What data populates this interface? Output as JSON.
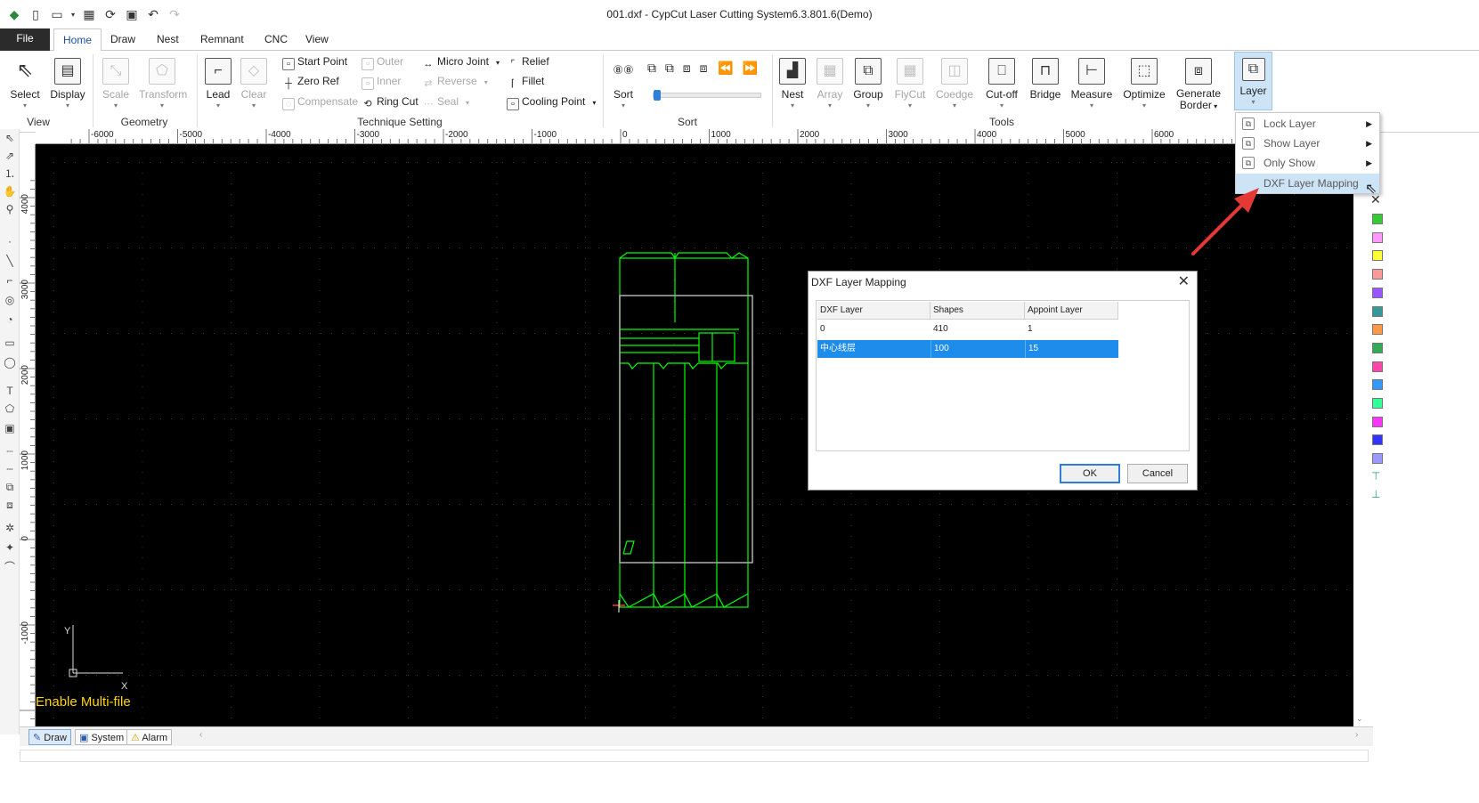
{
  "window": {
    "title": "001.dxf - CypCut Laser Cutting System6.3.801.6(Demo)"
  },
  "tabs": {
    "file": "File",
    "home": "Home",
    "draw": "Draw",
    "nest": "Nest",
    "remnant": "Remnant",
    "cnc": "CNC",
    "view": "View"
  },
  "ribbon": {
    "select": "Select",
    "display": "Display",
    "scale": "Scale",
    "transform": "Transform",
    "lead": "Lead",
    "clear": "Clear",
    "start_point": "Start Point",
    "zero_ref": "Zero Ref",
    "compensate": "Compensate",
    "outer": "Outer",
    "inner": "Inner",
    "ring_cut": "Ring Cut",
    "micro_joint": "Micro Joint",
    "reverse": "Reverse",
    "seal": "Seal",
    "relief": "Relief",
    "fillet": "Fillet",
    "cooling_point": "Cooling Point",
    "sort": "Sort",
    "nest": "Nest",
    "array": "Array",
    "group": "Group",
    "flycut": "FlyCut",
    "coedge": "Coedge",
    "cutoff": "Cut-off",
    "bridge": "Bridge",
    "measure": "Measure",
    "optimize": "Optimize",
    "generate_border_1": "Generate",
    "generate_border_2": "Border",
    "layer": "Layer",
    "groups": {
      "view": "View",
      "geometry": "Geometry",
      "technique": "Technique Setting",
      "sort": "Sort",
      "tools": "Tools"
    }
  },
  "ruler": {
    "top_ticks": [
      "-6000",
      "-5000",
      "-4000",
      "-3000",
      "-2000",
      "-1000",
      "0",
      "1000",
      "2000",
      "3000",
      "4000",
      "5000",
      "6000"
    ],
    "left_ticks": [
      "4000",
      "3000",
      "2000",
      "1000",
      "0",
      "-1000"
    ]
  },
  "canvas": {
    "axis_x": "X",
    "axis_y": "Y",
    "multifile": "Enable Multi-file",
    "part_color": "#00ff00"
  },
  "layer_menu": {
    "items": [
      {
        "label": "Lock Layer",
        "icon": "lock-layer-icon",
        "submenu": true
      },
      {
        "label": "Show Layer",
        "icon": "show-layer-icon",
        "submenu": true
      },
      {
        "label": "Only Show",
        "icon": "only-show-icon",
        "submenu": true
      },
      {
        "label": "DXF Layer Mapping",
        "icon": "",
        "submenu": false
      }
    ]
  },
  "dialog": {
    "title": "DXF Layer Mapping",
    "columns": [
      "DXF Layer",
      "Shapes",
      "Appoint Layer"
    ],
    "rows": [
      {
        "dxf_layer": "0",
        "shapes": "410",
        "appoint_layer": "1"
      },
      {
        "dxf_layer": "中心线层",
        "shapes": "100",
        "appoint_layer": "15"
      }
    ],
    "ok": "OK",
    "cancel": "Cancel"
  },
  "palette": {
    "colors": [
      "#33cc33",
      "#ff99ff",
      "#ffff33",
      "#ff9999",
      "#9955ff",
      "#339999",
      "#ff9944",
      "#33aa55",
      "#ff44aa",
      "#3399ff",
      "#33ff99",
      "#ff33ff",
      "#3333ff",
      "#9999ff"
    ]
  },
  "bottom_tabs": {
    "draw": "Draw",
    "system": "System",
    "alarm": "Alarm"
  }
}
